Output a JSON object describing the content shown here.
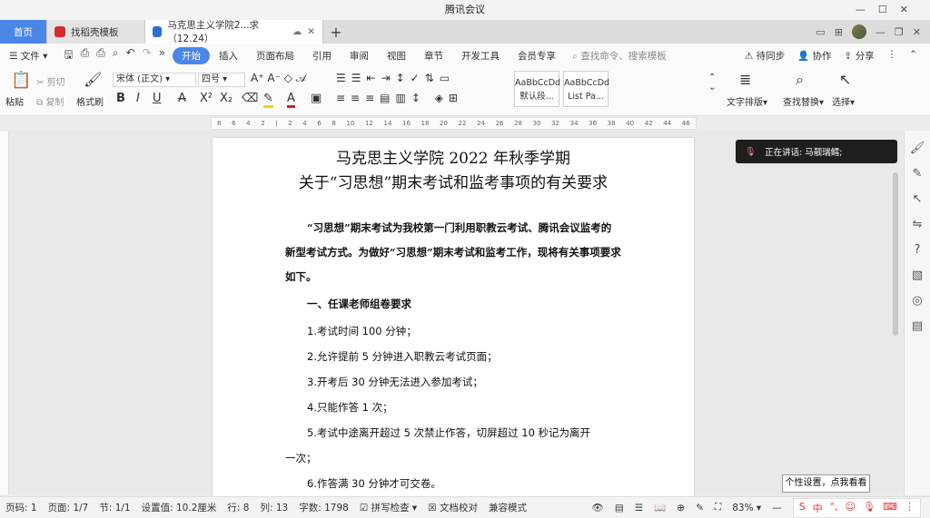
{
  "window": {
    "title": "腾讯会议"
  },
  "tabs": [
    {
      "label": "首页"
    },
    {
      "label": "找稻壳模板"
    },
    {
      "label": "马克思主义学院2...求（12.24）"
    }
  ],
  "menu": {
    "file": "文件",
    "items": [
      "开始",
      "插入",
      "页面布局",
      "引用",
      "审阅",
      "视图",
      "章节",
      "开发工具",
      "会员专享"
    ],
    "search_placeholder": "查找命令、搜索模板",
    "right": [
      "待同步",
      "协作",
      "分享"
    ]
  },
  "ribbon": {
    "paste": "粘贴",
    "cut": "剪切",
    "copy": "复制",
    "format_painter": "格式刷",
    "font_name": "宋体 (正文)",
    "font_size": "四号",
    "style1_preview": "AaBbCcDd",
    "style1_label": "默认段...",
    "style2_preview": "AaBbCcDd",
    "style2_label": "List Pa...",
    "text_layout": "文字排版",
    "find_replace": "查找替换",
    "select": "选择"
  },
  "ruler_ticks": [
    "8",
    "6",
    "4",
    "2",
    "",
    "2",
    "4",
    "6",
    "8",
    "10",
    "12",
    "14",
    "16",
    "18",
    "20",
    "22",
    "24",
    "26",
    "28",
    "30",
    "32",
    "34",
    "36",
    "38",
    "40",
    "42",
    "44",
    "46"
  ],
  "document": {
    "title1": "马克思主义学院 2022 年秋季学期",
    "title2": "关于“习思想”期末考试和监考事项的有关要求",
    "lead": "“习思想”期末考试为我校第一门利用职教云考试、腾讯会议监考的新型考试方式。为做好“习思想”期末考试和监考工作，现将有关事项要求如下。",
    "section1": "一、任课老师组卷要求",
    "items": [
      "1.考试时间 100 分钟；",
      "2.允许提前 5 分钟进入职教云考试页面；",
      "3.开考后 30 分钟无法进入参加考试；",
      "4.只能作答 1 次；",
      "5.考试中途离开超过  5  次禁止作答，切屏超过  10  秒记为离开",
      "一次；",
      "6.作答满 30 分钟才可交卷。"
    ]
  },
  "overlay": {
    "speaking": "正在讲话: 马靓瑞鳕;"
  },
  "tooltip": "个性设置，点我看看",
  "status": {
    "page_num": "页码: 1",
    "pages": "页面: 1/7",
    "section": "节: 1/1",
    "setting": "设置值: 10.2厘米",
    "row": "行: 8",
    "col": "列: 13",
    "words": "字数: 1798",
    "spellcheck": "拼写检查",
    "proof": "文档校对",
    "compat": "兼容模式",
    "zoom": "83%"
  },
  "colors": {
    "accent": "#4a86e8",
    "highlight": "#f5d400",
    "font_color": "#d02020"
  }
}
